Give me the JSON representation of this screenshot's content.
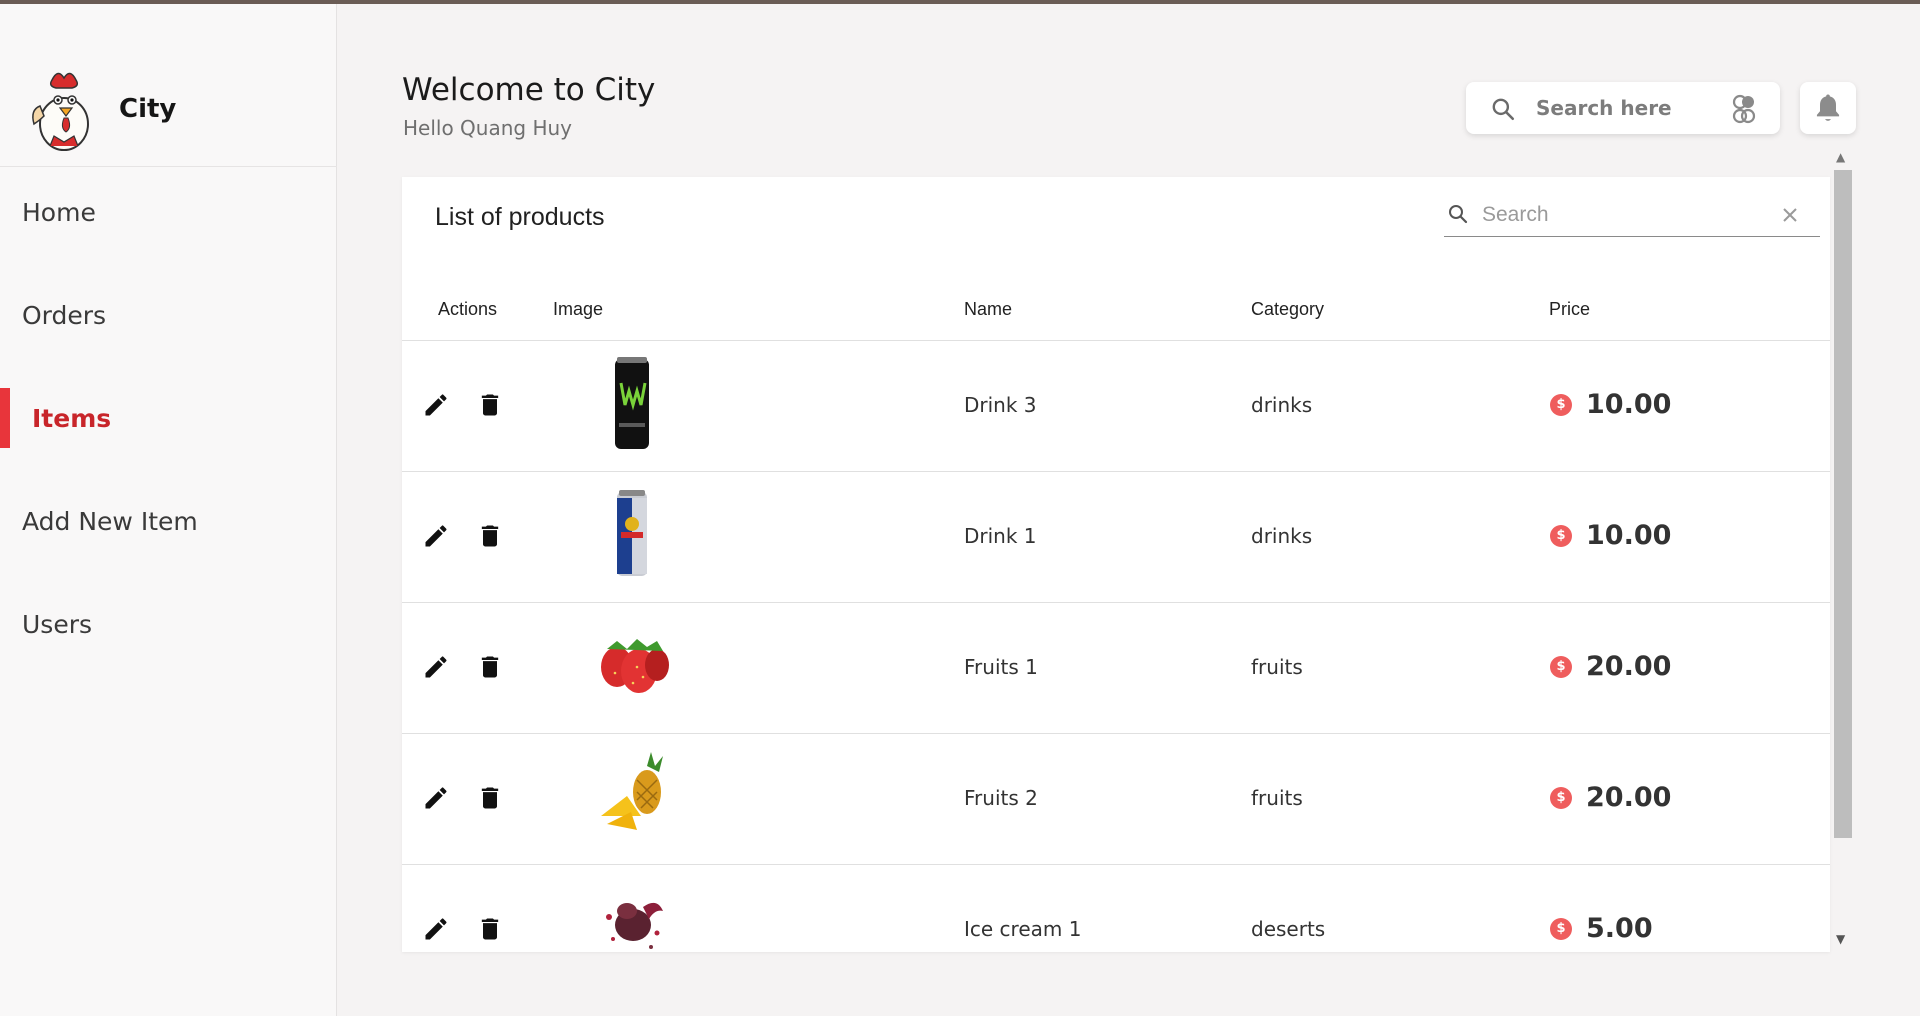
{
  "brand": {
    "name": "City"
  },
  "sidebar": {
    "items": [
      {
        "label": "Home"
      },
      {
        "label": "Orders"
      },
      {
        "label": "Items"
      },
      {
        "label": "Add New Item"
      },
      {
        "label": "Users"
      }
    ],
    "active_index": 2
  },
  "header": {
    "title": "Welcome to City",
    "greeting": "Hello Quang Huy",
    "search_placeholder": "Search here"
  },
  "table": {
    "title": "List of products",
    "search_placeholder": "Search",
    "columns": [
      "Actions",
      "Image",
      "Name",
      "Category",
      "Price"
    ],
    "rows": [
      {
        "name": "Drink 3",
        "category": "drinks",
        "price": "10.00",
        "image": "can-green-icon"
      },
      {
        "name": "Drink 1",
        "category": "drinks",
        "price": "10.00",
        "image": "can-blue-icon"
      },
      {
        "name": "Fruits 1",
        "category": "fruits",
        "price": "20.00",
        "image": "strawberry-icon"
      },
      {
        "name": "Fruits 2",
        "category": "fruits",
        "price": "20.00",
        "image": "pineapple-icon"
      },
      {
        "name": "Ice cream 1",
        "category": "deserts",
        "price": "5.00",
        "image": "ice-cream-icon"
      }
    ]
  },
  "colors": {
    "accent": "#e8353b",
    "active_text": "#c8252a",
    "coin": "#ef5d5d"
  }
}
